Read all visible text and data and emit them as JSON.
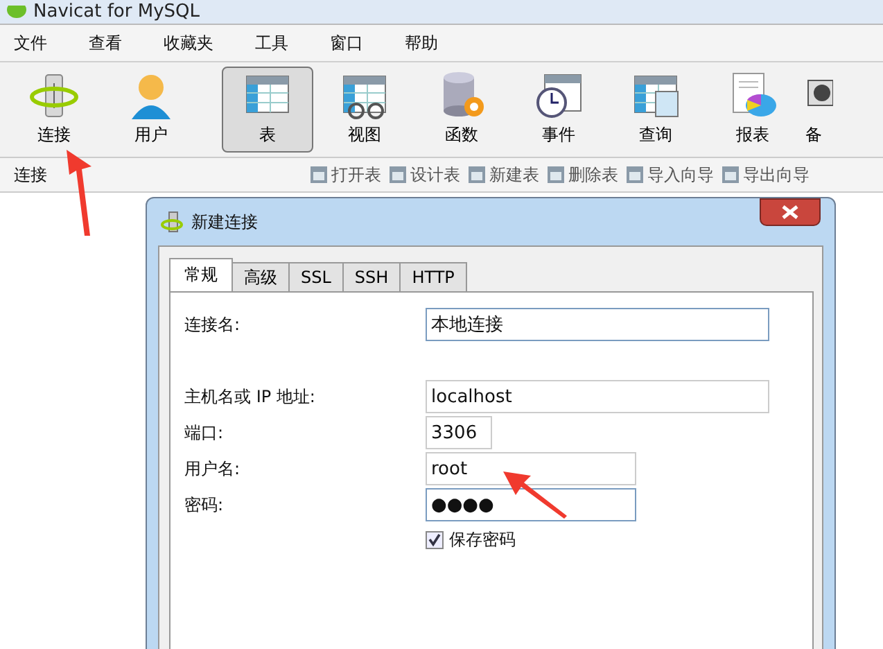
{
  "window": {
    "title": "Navicat for MySQL"
  },
  "menu": [
    "文件",
    "查看",
    "收藏夹",
    "工具",
    "窗口",
    "帮助"
  ],
  "toolbar": [
    {
      "label": "连接",
      "kind": "connect",
      "selected": false
    },
    {
      "label": "用户",
      "kind": "user",
      "selected": false
    },
    {
      "label": "表",
      "kind": "table",
      "selected": true
    },
    {
      "label": "视图",
      "kind": "view",
      "selected": false
    },
    {
      "label": "函数",
      "kind": "function",
      "selected": false
    },
    {
      "label": "事件",
      "kind": "event",
      "selected": false
    },
    {
      "label": "查询",
      "kind": "query",
      "selected": false
    },
    {
      "label": "报表",
      "kind": "report",
      "selected": false
    },
    {
      "label": "备",
      "kind": "backup",
      "selected": false
    }
  ],
  "sidebar": {
    "title": "连接"
  },
  "object_toolbar": [
    "打开表",
    "设计表",
    "新建表",
    "删除表",
    "导入向导",
    "导出向导"
  ],
  "dialog": {
    "title": "新建连接",
    "tabs": [
      {
        "label": "常规",
        "selected": true
      },
      {
        "label": "高级",
        "selected": false
      },
      {
        "label": "SSL",
        "selected": false
      },
      {
        "label": "SSH",
        "selected": false
      },
      {
        "label": "HTTP",
        "selected": false
      }
    ],
    "fields": [
      {
        "label": "连接名:",
        "value": "本地连接",
        "focused": true
      },
      {
        "label": "主机名或 IP 地址:",
        "value": "localhost",
        "focused": false
      },
      {
        "label": "端口:",
        "value": "3306",
        "focused": false
      },
      {
        "label": "用户名:",
        "value": "root",
        "focused": false
      },
      {
        "label": "密码:",
        "value": "●●●●",
        "focused": true
      }
    ],
    "save_password": {
      "label": "保存密码",
      "checked": true
    }
  }
}
